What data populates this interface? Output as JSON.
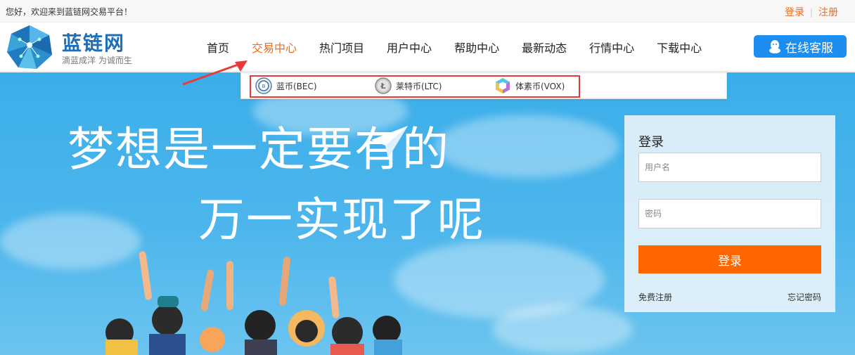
{
  "topbar": {
    "welcome": "您好，欢迎来到蓝链网交易平台！",
    "login_link": "登录",
    "separator": "|",
    "register_link": "注册"
  },
  "logo": {
    "name": "蓝链网",
    "slogan": "滴蓝成洋 为诚而生"
  },
  "nav": {
    "items": [
      {
        "label": "首页"
      },
      {
        "label": "交易中心",
        "active": true
      },
      {
        "label": "热门项目"
      },
      {
        "label": "用户中心"
      },
      {
        "label": "帮助中心"
      },
      {
        "label": "最新动态"
      },
      {
        "label": "行情中心"
      },
      {
        "label": "下载中心"
      }
    ]
  },
  "customer_service": {
    "label": "在线客服",
    "icon": "qq-penguin-icon"
  },
  "submenu": {
    "coins": [
      {
        "label": "蓝币(BEC)",
        "icon": "bec-coin-icon"
      },
      {
        "label": "莱特币(LTC)",
        "icon": "ltc-coin-icon"
      },
      {
        "label": "体素币(VOX)",
        "icon": "vox-coin-icon"
      }
    ]
  },
  "hero": {
    "line1": "梦想是一定要有的",
    "line2": "万一实现了呢"
  },
  "login_panel": {
    "title": "登录",
    "username_placeholder": "用户名",
    "password_placeholder": "密码",
    "submit_label": "登录",
    "register_label": "免费注册",
    "forgot_label": "忘记密码"
  },
  "colors": {
    "accent_orange": "#f26b1d",
    "button_orange": "#ff6600",
    "brand_blue": "#1f6fb8",
    "service_blue": "#1b8ef0",
    "hero_sky": "#3aaee9",
    "annotation_red": "#e83a3a"
  }
}
